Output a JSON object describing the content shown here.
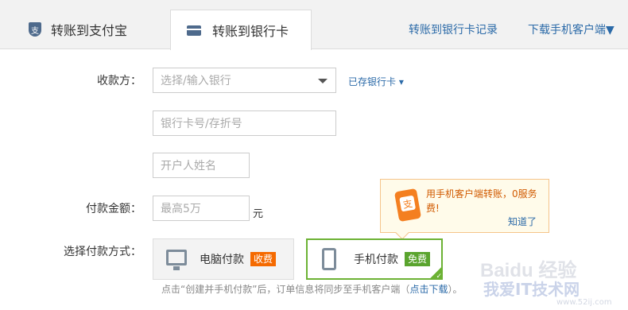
{
  "tabs": [
    {
      "label": "转账到支付宝",
      "icon": "alipay-shield-icon",
      "icon_char": "支",
      "active": false
    },
    {
      "label": "转账到银行卡",
      "icon": "bank-card-icon",
      "active": true
    }
  ],
  "top_links": {
    "records": "转账到银行卡记录",
    "download": "下载手机客户端▼"
  },
  "form": {
    "payee_label": "收款方：",
    "bank_select_placeholder": "选择/输入银行",
    "saved_cards": "已存银行卡 ▾",
    "card_number_placeholder": "银行卡号/存折号",
    "account_name_placeholder": "开户人姓名",
    "amount_label": "付款金额：",
    "amount_placeholder": "最高5万",
    "amount_unit": "元",
    "method_label": "选择付款方式："
  },
  "tooltip": {
    "icon_char": "支",
    "text": "用手机客户端转账，0服务费!",
    "dismiss": "知道了"
  },
  "payment_methods": [
    {
      "label": "电脑付款",
      "badge": "收费",
      "icon": "monitor-icon",
      "selected": false
    },
    {
      "label": "手机付款",
      "badge": "免费",
      "icon": "phone-icon",
      "selected": true
    }
  ],
  "note": {
    "prefix": "点击“创建并手机付款”后，订单信息将同步至手机客户端（",
    "link": "点击下载",
    "suffix": "）。"
  },
  "watermark": {
    "brand": "Baidu 经验",
    "site_name": "我爱IT技术网",
    "url": "www.52ij.com"
  },
  "colors": {
    "link": "#2b6aa8",
    "fee_badge": "#f56a00",
    "free_badge": "#5aa42e",
    "selected_border": "#6cb234",
    "tooltip_text": "#d15a00"
  }
}
